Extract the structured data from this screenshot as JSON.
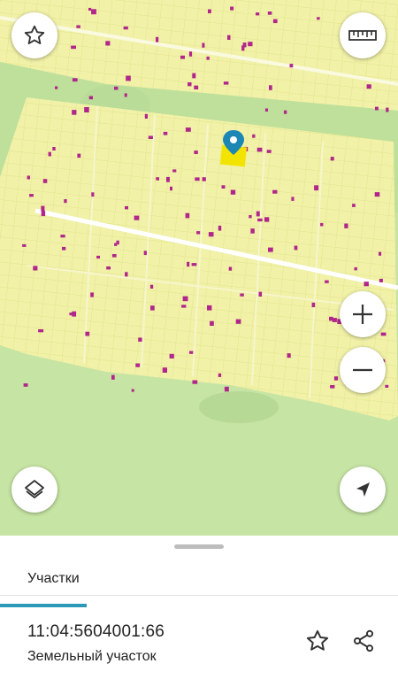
{
  "map": {
    "icons": {
      "favorite": "star-outline-icon",
      "measure": "ruler-icon",
      "zoom_in": "plus-icon",
      "zoom_out": "minus-icon",
      "layers": "layers-icon",
      "locate": "navigation-arrow-icon",
      "marker": "map-pin-icon"
    },
    "colors": {
      "parcel_fill": "#f1f1a8",
      "parcel_stroke": "#e3e58d",
      "building": "#b0268a",
      "field": "#c9e4a1",
      "road": "#ffffff",
      "selected_parcel": "#f3e400",
      "marker": "#1c86b4"
    }
  },
  "sheet": {
    "tab_label": "Участки",
    "parcel_id": "11:04:5604001:66",
    "parcel_type": "Земельный участок",
    "icons": {
      "favorite": "star-outline-icon",
      "share": "share-icon"
    }
  }
}
